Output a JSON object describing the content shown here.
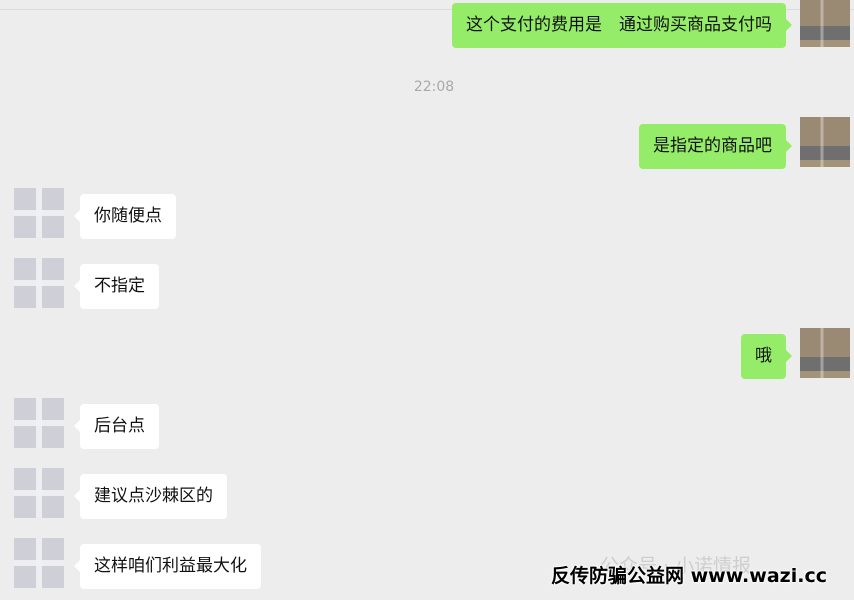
{
  "timestamp": "22:08",
  "messages": [
    {
      "sender": "self",
      "text": "这个支付的费用是　通过购买商品支付吗"
    },
    {
      "sender": "self",
      "text": "是指定的商品吧"
    },
    {
      "sender": "other",
      "text": "你随便点"
    },
    {
      "sender": "other",
      "text": "不指定"
    },
    {
      "sender": "self",
      "text": "哦"
    },
    {
      "sender": "other",
      "text": "后台点"
    },
    {
      "sender": "other",
      "text": "建议点沙棘区的"
    },
    {
      "sender": "other",
      "text": "这样咱们利益最大化"
    }
  ],
  "watermark": {
    "faint_text": "公众号 · 小诺情报",
    "bold_text": "反传防骗公益网 www.wazi.cc"
  },
  "colors": {
    "background": "#ededed",
    "self_bubble": "#95ec69",
    "other_bubble": "#ffffff"
  }
}
